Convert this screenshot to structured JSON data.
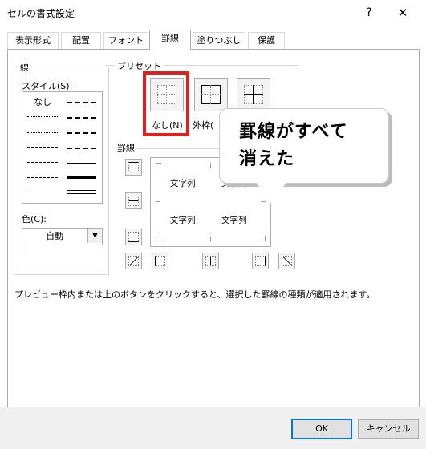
{
  "window": {
    "title": "セルの書式設定",
    "help": "?",
    "close": "✕"
  },
  "tabs": [
    {
      "label": "表示形式"
    },
    {
      "label": "配置"
    },
    {
      "label": "フォント"
    },
    {
      "label": "罫線"
    },
    {
      "label": "塗りつぶし"
    },
    {
      "label": "保護"
    }
  ],
  "active_tab": "罫線",
  "line_group": {
    "title": "線",
    "style_label": "スタイル(S):",
    "none_label": "なし",
    "color_label": "色(C):",
    "color_value": "自動"
  },
  "preset_group": {
    "title": "プリセット",
    "none_label": "なし(N)",
    "outline_label": "外枠(",
    "highlight_color": "#e2201a"
  },
  "border_group": {
    "title": "罫線"
  },
  "preview": {
    "cell_text": "文字列"
  },
  "callout": {
    "line1": "罫線がすべて",
    "line2": "消えた"
  },
  "note": "プレビュー枠内または上のボタンをクリックすると、選択した罫線の種類が適用されます。",
  "buttons": {
    "ok": "OK",
    "cancel": "キャンセル"
  },
  "colors": {
    "accent": "#0078d7"
  }
}
